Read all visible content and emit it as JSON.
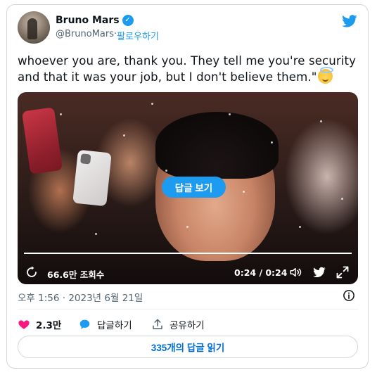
{
  "author": {
    "name": "Bruno Mars",
    "handle": "@BrunoMars",
    "separator": " · ",
    "follow_label": "팔로우하기",
    "verified_icon": "verified-badge-icon"
  },
  "tweet": {
    "text": "whoever you are, thank you. They tell me you're security and that it was your job, but I don't believe them.\"",
    "emoji": "smiling-face-with-halo"
  },
  "video": {
    "reply_button_label": "답글 보기",
    "views": "66.6만 조회수",
    "time": "0:24 / 0:24",
    "progress": 1.0
  },
  "meta": {
    "timestamp": "오후 1:56 · 2023년 6월 21일"
  },
  "actions": {
    "like_count": "2.3만",
    "reply_label": "답글하기",
    "share_label": "공유하기"
  },
  "read_replies_label": "335개의 답글 읽기",
  "colors": {
    "brand_blue": "#1d9bf0",
    "like_pink": "#f91880",
    "muted": "#536471",
    "border": "#cfd9de"
  }
}
